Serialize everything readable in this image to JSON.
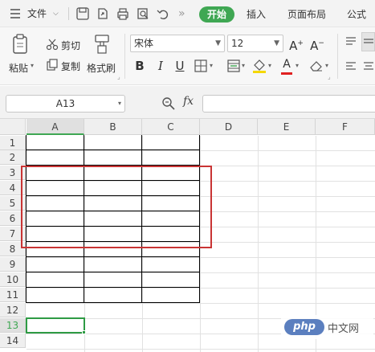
{
  "menubar": {
    "file_label": "文件",
    "tabs": [
      "开始",
      "插入",
      "页面布局",
      "公式"
    ],
    "active_tab": "开始",
    "more": "»"
  },
  "ribbon": {
    "paste": "粘贴",
    "cut": "剪切",
    "copy": "复制",
    "format_painter": "格式刷",
    "font_name": "宋体",
    "font_size": "12",
    "bold": "B",
    "italic": "I",
    "underline": "U",
    "grow_font": "A",
    "shrink_font": "A",
    "font_color_letter": "A",
    "accent_color": "#3fa753"
  },
  "formula_bar": {
    "name_box": "A13",
    "fx": "fx",
    "value": ""
  },
  "sheet": {
    "columns": [
      "A",
      "B",
      "C",
      "D",
      "E",
      "F"
    ],
    "selected_column": "A",
    "rows": [
      "1",
      "2",
      "3",
      "4",
      "5",
      "6",
      "7",
      "8",
      "9",
      "10",
      "11",
      "12",
      "13",
      "14"
    ],
    "selected_row": "13",
    "selection_color": "#2e9b44",
    "highlight_color": "#c93434"
  },
  "watermark": {
    "logo": "php",
    "text": "中文网"
  }
}
